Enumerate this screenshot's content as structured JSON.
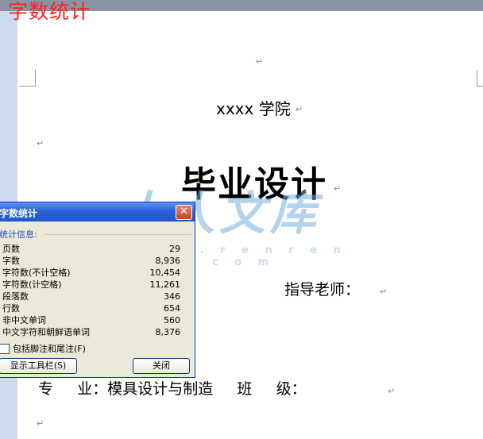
{
  "caption": "字数统计",
  "document": {
    "school": "xxxx 学院",
    "title": "毕业设计",
    "advisor_label": "指导老师：",
    "major_row": "专     业：模具设计与制造     班     级：",
    "paragraph_mark": "↵"
  },
  "watermark": {
    "text": "人人文库",
    "url": "w w w . r e n r e n d o c . c o m"
  },
  "dialog": {
    "title": "字数统计",
    "close_glyph": "✕",
    "group_label": "统计信息:",
    "stats": [
      {
        "label": "页数",
        "value": "29"
      },
      {
        "label": "字数",
        "value": "8,936"
      },
      {
        "label": "字符数(不计空格)",
        "value": "10,454"
      },
      {
        "label": "字符数(计空格)",
        "value": "11,261"
      },
      {
        "label": "段落数",
        "value": "346"
      },
      {
        "label": "行数",
        "value": "654"
      },
      {
        "label": "非中文单词",
        "value": "560"
      },
      {
        "label": "中文字符和朝鲜语单词",
        "value": "8,376"
      }
    ],
    "checkbox_label": "包括脚注和尾注(F)",
    "toolbar_button": "显示工具栏(S)",
    "close_button": "关闭"
  }
}
